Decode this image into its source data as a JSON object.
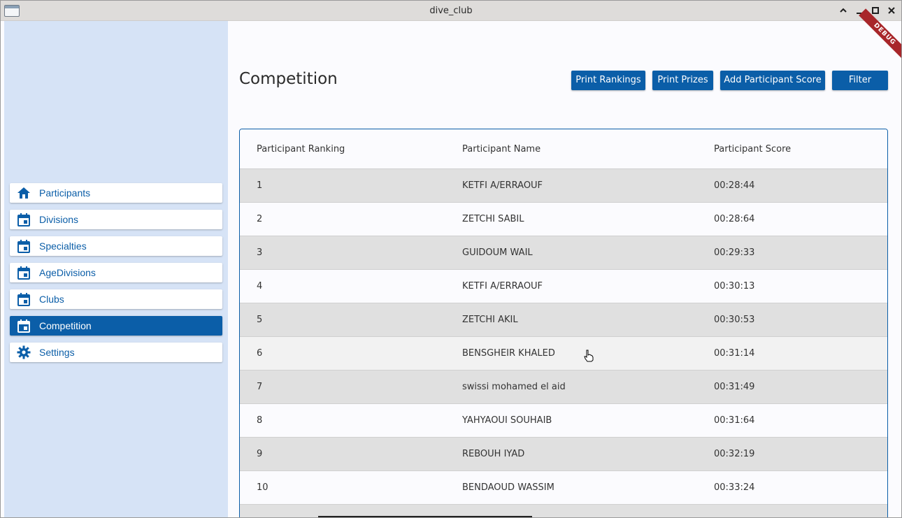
{
  "window": {
    "title": "dive_club",
    "debug_label": "DEBUG"
  },
  "sidebar": {
    "items": [
      {
        "label": "Participants",
        "icon": "home-icon",
        "active": false
      },
      {
        "label": "Divisions",
        "icon": "calendar-icon",
        "active": false
      },
      {
        "label": "Specialties",
        "icon": "calendar-icon",
        "active": false
      },
      {
        "label": "AgeDivisions",
        "icon": "calendar-icon",
        "active": false
      },
      {
        "label": "Clubs",
        "icon": "calendar-icon",
        "active": false
      },
      {
        "label": "Competition",
        "icon": "calendar-icon",
        "active": true
      },
      {
        "label": "Settings",
        "icon": "gear-icon",
        "active": false
      }
    ]
  },
  "main": {
    "title": "Competition",
    "buttons": {
      "print_rankings": "Print Rankings",
      "print_prizes": "Print Prizes",
      "add_score": "Add Participant Score",
      "filter": "Filter"
    },
    "table": {
      "headers": [
        "Participant Ranking",
        "Participant Name",
        "Participant Score"
      ],
      "rows": [
        [
          "1",
          "KETFI A/ERRAOUF",
          "00:28:44"
        ],
        [
          "2",
          "ZETCHI SABIL",
          "00:28:64"
        ],
        [
          "3",
          "GUIDOUM WAIL",
          "00:29:33"
        ],
        [
          "4",
          "KETFI A/ERRAOUF",
          "00:30:13"
        ],
        [
          "5",
          "ZETCHI AKIL",
          "00:30:53"
        ],
        [
          "6",
          "BENSGHEIR KHALED",
          "00:31:14"
        ],
        [
          "7",
          "swissi mohamed el aid",
          "00:31:49"
        ],
        [
          "8",
          "YAHYAOUI SOUHAIB",
          "00:31:64"
        ],
        [
          "9",
          "REBOUH IYAD",
          "00:32:19"
        ],
        [
          "10",
          "BENDAOUD WASSIM",
          "00:33:24"
        ]
      ]
    }
  },
  "colors": {
    "accent": "#0b5ea8",
    "sidebar_bg": "#d6e3f6",
    "row_alt": "#e0e0e0"
  }
}
